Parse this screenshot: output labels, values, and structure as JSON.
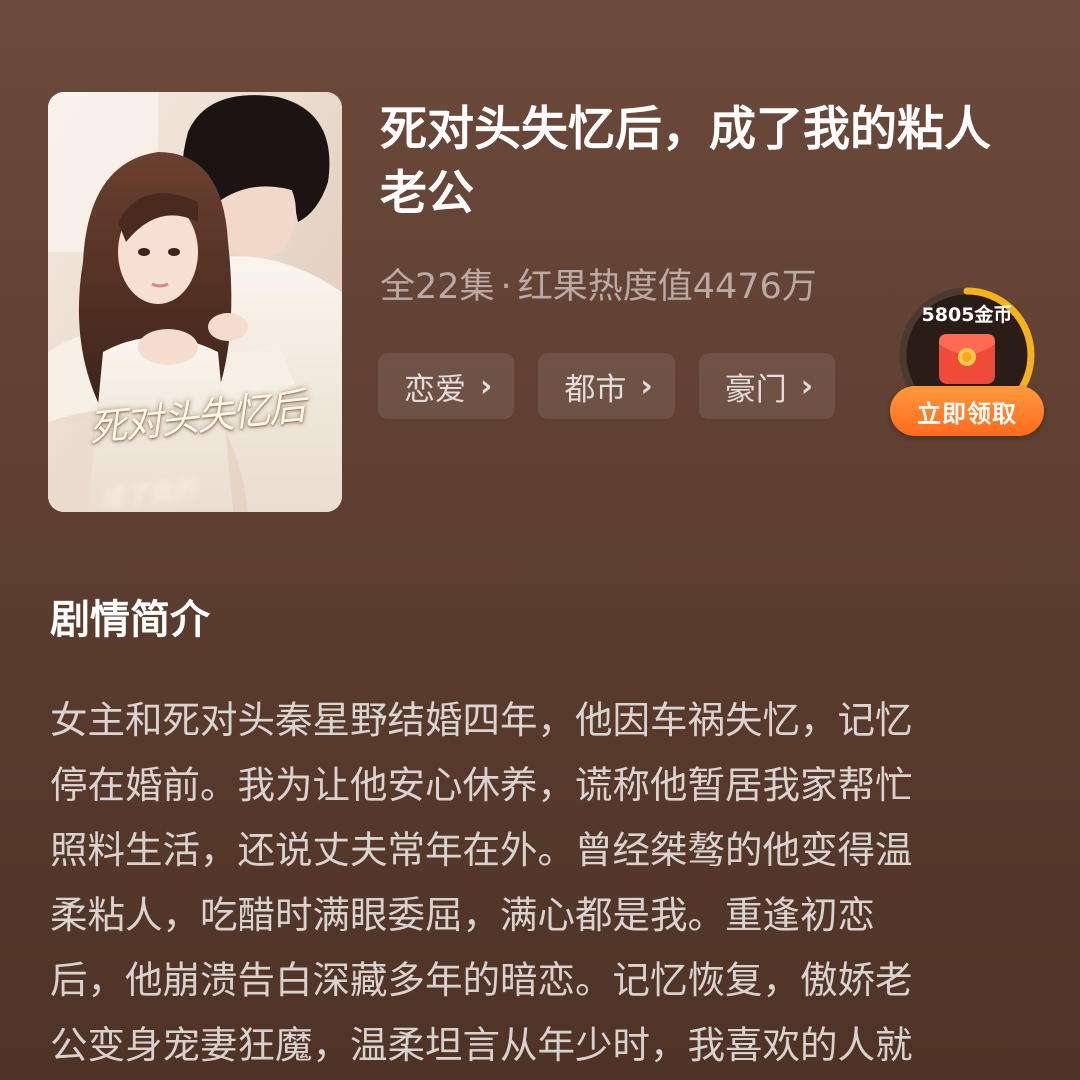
{
  "drama": {
    "title": "死对头失忆后，成了我的粘人老公",
    "episodes": "全22集",
    "separator": "·",
    "heat": "红果热度值4476万",
    "poster_title": "死对头失忆后",
    "poster_subtitle": "成了我的"
  },
  "tags": [
    {
      "label": "恋爱",
      "icon": "chevron-right-icon"
    },
    {
      "label": "都市",
      "icon": "chevron-right-icon"
    },
    {
      "label": "豪门",
      "icon": "chevron-right-icon"
    }
  ],
  "reward": {
    "coins": "5805金币",
    "button_label": "立即领取",
    "icon": "red-envelope-icon",
    "progress": 0.6,
    "accent": "#f7b21b",
    "button_color": "#ff7a24"
  },
  "synopsis": {
    "heading": "剧情简介",
    "lines": [
      "女主和死对头秦星野结婚四年，他因车祸失忆，记忆",
      "停在婚前。我为让他安心休养，谎称他暂居我家帮忙",
      "照料生活，还说丈夫常年在外。曾经桀骜的他变得温",
      "柔粘人，吃醋时满眼委屈，满心都是我。重逢初恋",
      "后，他崩溃告白深藏多年的暗恋。记忆恢复，傲娇老",
      "公变身宠妻狂魔，温柔坦言从年少时，我喜欢的人就"
    ]
  }
}
